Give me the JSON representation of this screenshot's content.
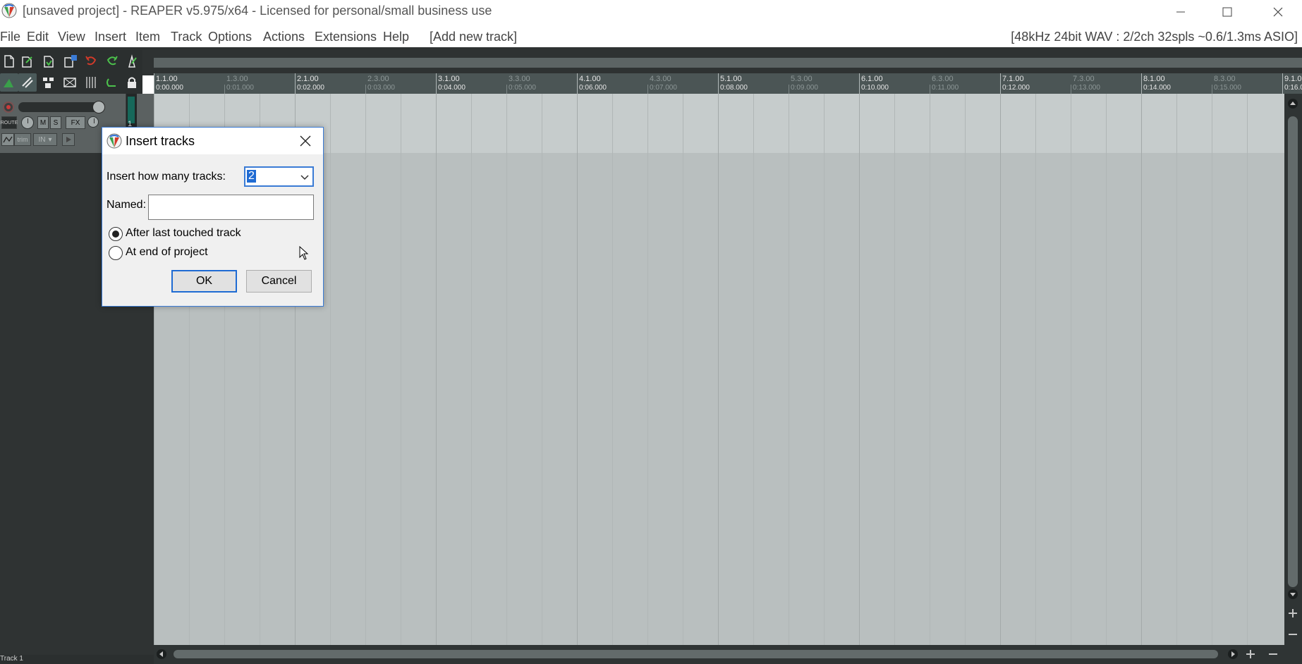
{
  "window": {
    "title": "[unsaved project] - REAPER v5.975/x64 - Licensed for personal/small business use"
  },
  "menubar": {
    "items": [
      "File",
      "Edit",
      "View",
      "Insert",
      "Item",
      "Track",
      "Options",
      "Actions",
      "Extensions",
      "Help",
      "[Add new track]"
    ],
    "status": "[48kHz 24bit WAV : 2/2ch 32spls ~0.6/1.3ms ASIO]"
  },
  "ruler": {
    "major": [
      {
        "bar": "1.1.00",
        "time": "0:00.000"
      },
      {
        "bar": "2.1.00",
        "time": "0:02.000"
      },
      {
        "bar": "3.1.00",
        "time": "0:04.000"
      },
      {
        "bar": "4.1.00",
        "time": "0:06.000"
      },
      {
        "bar": "5.1.00",
        "time": "0:08.000"
      },
      {
        "bar": "6.1.00",
        "time": "0:10.000"
      },
      {
        "bar": "7.1.00",
        "time": "0:12.000"
      },
      {
        "bar": "8.1.00",
        "time": "0:14.000"
      },
      {
        "bar": "9.1.0",
        "time": "0:16.0"
      }
    ],
    "minor": [
      {
        "bar": "1.3.00",
        "time": "0:01.000"
      },
      {
        "bar": "2.3.00",
        "time": "0:03.000"
      },
      {
        "bar": "3.3.00",
        "time": "0:05.000"
      },
      {
        "bar": "4.3.00",
        "time": "0:07.000"
      },
      {
        "bar": "5.3.00",
        "time": "0:09.000"
      },
      {
        "bar": "6.3.00",
        "time": "0:11.000"
      },
      {
        "bar": "7.3.00",
        "time": "0:13.000"
      },
      {
        "bar": "8.3.00",
        "time": "0:15.000"
      }
    ]
  },
  "track": {
    "number": "1",
    "mute_label": "M",
    "solo_label": "S",
    "fx_label": "FX",
    "route_label": "ROUTE",
    "trim_label": "trim",
    "in_label": "IN",
    "footer_name": "Track 1"
  },
  "dialog": {
    "title": "Insert tracks",
    "count_label": "Insert how many tracks:",
    "count_value": "2",
    "named_label": "Named:",
    "named_value": "",
    "options": [
      {
        "label": "After last touched track",
        "checked": true
      },
      {
        "label": "At end of project",
        "checked": false
      }
    ],
    "ok_label": "OK",
    "cancel_label": "Cancel"
  },
  "colors": {
    "accent": "#1f6bd3",
    "arrange_bg": "#b9bfbf",
    "track_panel": "#5b6161"
  }
}
